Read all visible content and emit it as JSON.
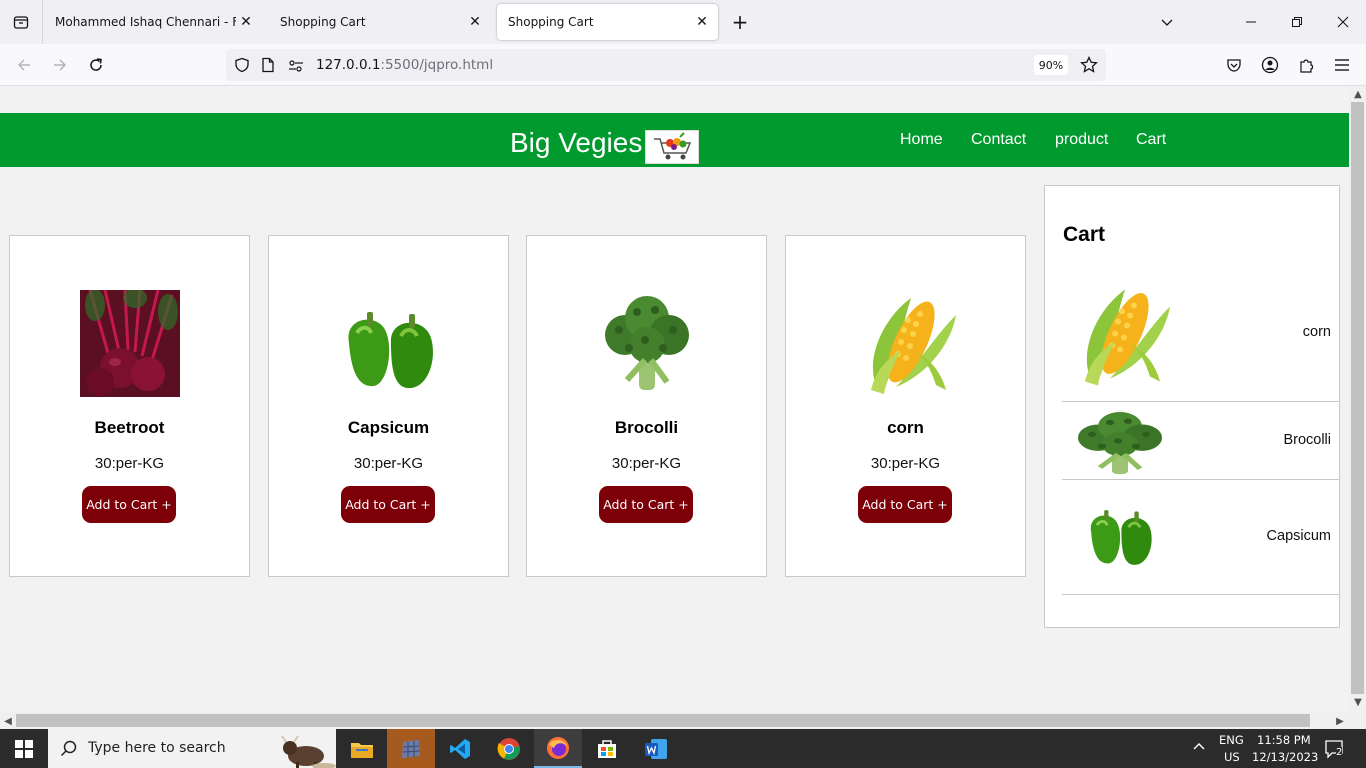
{
  "browser": {
    "tabs": [
      {
        "title": "Mohammed Ishaq Chennari - Fullst",
        "active": false
      },
      {
        "title": "Shopping Cart",
        "active": false
      },
      {
        "title": "Shopping Cart",
        "active": true
      }
    ],
    "url": {
      "host": "127.0.0.1",
      "rest": ":5500/jqpro.html"
    },
    "zoom": "90%"
  },
  "site": {
    "brand": "Big Vegies",
    "nav": [
      "Home",
      "Contact",
      "product",
      "Cart"
    ],
    "header_color": "#009a2e",
    "button_color": "#7d0009"
  },
  "products": [
    {
      "name": "Beetroot",
      "price": "30:per-KG",
      "button": "Add to Cart +",
      "icon": "beetroot-image"
    },
    {
      "name": "Capsicum",
      "price": "30:per-KG",
      "button": "Add to Cart +",
      "icon": "capsicum-image"
    },
    {
      "name": "Brocolli",
      "price": "30:per-KG",
      "button": "Add to Cart +",
      "icon": "broccoli-image"
    },
    {
      "name": "corn",
      "price": "30:per-KG",
      "button": "Add to Cart +",
      "icon": "corn-image"
    }
  ],
  "cart": {
    "title": "Cart",
    "items": [
      {
        "name": "corn",
        "icon": "corn-image"
      },
      {
        "name": "Brocolli",
        "icon": "broccoli-image"
      },
      {
        "name": "Capsicum",
        "icon": "capsicum-image"
      }
    ]
  },
  "taskbar": {
    "search_placeholder": "Type here to search",
    "lang_top": "ENG",
    "lang_bottom": "US",
    "time": "11:58 PM",
    "date": "12/13/2023",
    "notifications": "2"
  }
}
